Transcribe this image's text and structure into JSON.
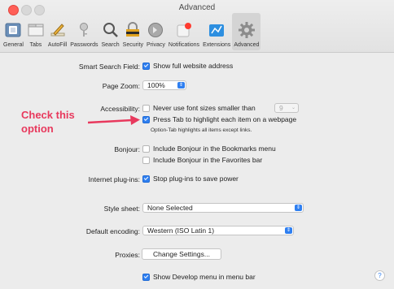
{
  "window": {
    "title": "Advanced",
    "tabs": [
      {
        "label": "General",
        "icon": "general-icon"
      },
      {
        "label": "Tabs",
        "icon": "tabs-icon"
      },
      {
        "label": "AutoFill",
        "icon": "pencil-icon"
      },
      {
        "label": "Passwords",
        "icon": "key-icon"
      },
      {
        "label": "Search",
        "icon": "search-icon"
      },
      {
        "label": "Security",
        "icon": "security-icon"
      },
      {
        "label": "Privacy",
        "icon": "privacy-icon"
      },
      {
        "label": "Notifications",
        "icon": "notifications-icon"
      },
      {
        "label": "Extensions",
        "icon": "puzzle-icon"
      },
      {
        "label": "Advanced",
        "icon": "gear-icon",
        "active": true
      }
    ]
  },
  "settings": {
    "smart_search": {
      "label": "Smart Search Field:",
      "option": "Show full website address",
      "checked": true
    },
    "page_zoom": {
      "label": "Page Zoom:",
      "value": "100%"
    },
    "accessibility": {
      "label": "Accessibility:",
      "font_option": "Never use font sizes smaller than",
      "font_size": "9",
      "tab_option": "Press Tab to highlight each item on a webpage",
      "tab_checked": true,
      "hint": "Option-Tab highlights all items except links."
    },
    "bonjour": {
      "label": "Bonjour:",
      "bookmarks_option": "Include Bonjour in the Bookmarks menu",
      "favorites_option": "Include Bonjour in the Favorites bar"
    },
    "plugins": {
      "label": "Internet plug-ins:",
      "option": "Stop plug-ins to save power",
      "checked": true
    },
    "style_sheet": {
      "label": "Style sheet:",
      "value": "None Selected"
    },
    "encoding": {
      "label": "Default encoding:",
      "value": "Western (ISO Latin 1)"
    },
    "proxies": {
      "label": "Proxies:",
      "button": "Change Settings..."
    },
    "develop": {
      "option": "Show Develop menu in menu bar",
      "checked": true
    }
  },
  "annotation": {
    "line1": "Check this",
    "line2": "option"
  },
  "help": "?",
  "colors": {
    "accent": "#2f7ff0",
    "callout": "#e8395d"
  }
}
